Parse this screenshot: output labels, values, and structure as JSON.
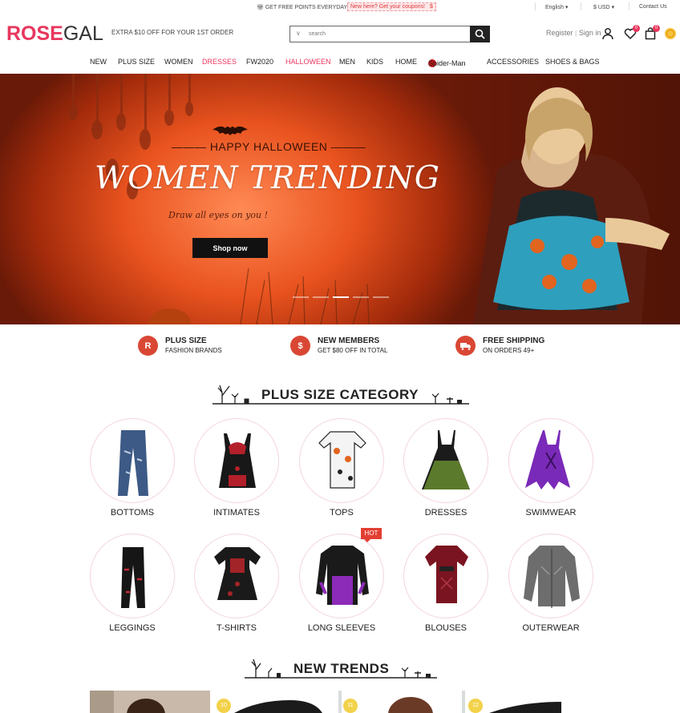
{
  "topbar": {
    "points": "GET FREE POINTS EVERYDAY",
    "coupon_text": "New here? Get your coupons!",
    "coupon_amount": "$",
    "language": "English",
    "currency": "$ USD",
    "contact": "Contact Us"
  },
  "header": {
    "logo_a": "ROSE",
    "logo_b": "GAL",
    "tagline": "EXTRA $10 OFF FOR YOUR 1ST ORDER",
    "search_placeholder": "search",
    "register": "Register",
    "sign_in": "Sign in",
    "wishlist_count": "0",
    "cart_count": "0"
  },
  "nav": [
    {
      "label": "NEW"
    },
    {
      "label": "PLUS SIZE"
    },
    {
      "label": "WOMEN"
    },
    {
      "label": "DRESSES"
    },
    {
      "label": "FW2020"
    },
    {
      "label": "HALLOWEEN"
    },
    {
      "label": "MEN"
    },
    {
      "label": "KIDS"
    },
    {
      "label": "HOME"
    },
    {
      "label": "Spider-Man"
    },
    {
      "label": "ACCESSORIES"
    },
    {
      "label": "SHOES & BAGS"
    }
  ],
  "hero": {
    "kicker": "HAPPY HALLOWEEN",
    "title": "WOMEN TRENDING",
    "subtitle": "Draw all eyes on you !",
    "cta": "Shop now"
  },
  "features": [
    {
      "icon": "R",
      "title": "PLUS SIZE",
      "sub": "FASHION BRANDS"
    },
    {
      "icon": "$",
      "title": "NEW MEMBERS",
      "sub": "GET $80 OFF IN TOTAL"
    },
    {
      "icon": "truck-icon",
      "title": "FREE SHIPPING",
      "sub": "ON ORDERS 49+"
    }
  ],
  "plus_size": {
    "title": "PLUS SIZE CATEGORY",
    "categories": [
      {
        "label": "BOTTOMS"
      },
      {
        "label": "INTIMATES"
      },
      {
        "label": "TOPS"
      },
      {
        "label": "DRESSES"
      },
      {
        "label": "SWIMWEAR"
      },
      {
        "label": "LEGGINGS"
      },
      {
        "label": "T-SHIRTS"
      },
      {
        "label": "LONG SLEEVES"
      },
      {
        "label": "BLOUSES"
      },
      {
        "label": "OUTERWEAR"
      }
    ],
    "hot_badge": "HOT"
  },
  "new_trends": {
    "title": "NEW TRENDS",
    "numbers": [
      "10",
      "11",
      "12"
    ]
  },
  "colors": {
    "brand": "#e8365d",
    "accent": "#d94734",
    "hero": "#e9531f"
  }
}
